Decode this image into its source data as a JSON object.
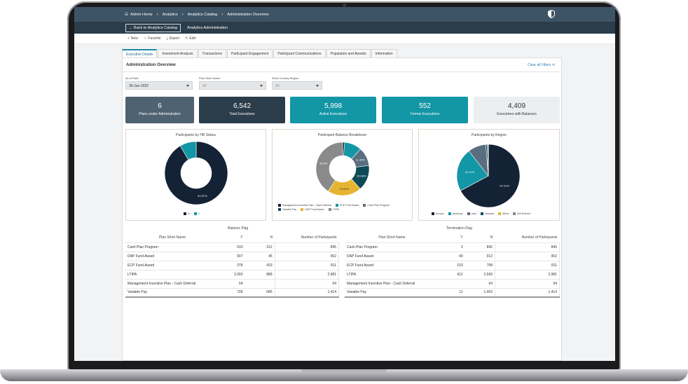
{
  "breadcrumbs": [
    "Admin Home",
    "Analytics",
    "Analytics Catalog",
    "Administration Overview"
  ],
  "subheader": {
    "back_label": "← Back to Analytics Catalog",
    "title": "Analytics Administration"
  },
  "actions": [
    {
      "icon": "+",
      "label": "New"
    },
    {
      "icon": "☆",
      "label": "Favorite"
    },
    {
      "icon": "⤓",
      "label": "Export"
    },
    {
      "icon": "✎",
      "label": "Edit"
    }
  ],
  "tabs": [
    "Executive Details",
    "Investment Analysis",
    "Transactions",
    "Participant Engagement",
    "Participant Communications",
    "Population and Awards",
    "Information"
  ],
  "panel": {
    "title": "Administration Overview",
    "clear_filters": "Clear all Filters ⟲"
  },
  "filters": [
    {
      "label": "As of Date",
      "value": "30-Jun-2022"
    },
    {
      "label": "Plan Short Name",
      "value": "All"
    },
    {
      "label": "Work Country Region",
      "value": "All"
    }
  ],
  "kpis": [
    {
      "value": "6",
      "label": "Plans under Administration",
      "color": "#4e6272"
    },
    {
      "value": "6,542",
      "label": "Total Executives",
      "color": "#2b3c4a"
    },
    {
      "value": "5,998",
      "label": "Active Executives",
      "color": "#1396a6"
    },
    {
      "value": "552",
      "label": "Former Executives",
      "color": "#1396a6"
    },
    {
      "value": "4,409",
      "label": "Executives with Balances",
      "color": "#eceef0",
      "text": "#333333"
    }
  ],
  "chart_data": [
    {
      "type": "pie",
      "title": "Participants by HR Status",
      "categories": [
        "N",
        "Y"
      ],
      "values": [
        91.57,
        8.43
      ],
      "colors": [
        "#142236",
        "#1396a6"
      ],
      "data_labels": [
        "91.57%",
        ""
      ]
    },
    {
      "type": "pie",
      "title": "Participant Balance Breakdown",
      "categories": [
        "Management Incentive Plan - Cash Deferral",
        "ECP Fund Award",
        "Cash Plan Program",
        "Variable Pay",
        "DAP Fund Award",
        "LTIPA"
      ],
      "values": [
        1.2,
        10.5,
        11.3,
        15.5,
        20.6,
        40.9
      ],
      "colors": [
        "#142236",
        "#1396a6",
        "#5a6e80",
        "#0e4a56",
        "#e6b52f",
        "#8a8a8a"
      ],
      "data_labels": [
        "",
        "",
        "11.30%",
        "15.48%",
        "20.63%",
        "40.9%"
      ]
    },
    {
      "type": "pie",
      "title": "Participants by Region",
      "categories": [
        "Europe",
        "Americas",
        "Asia",
        "Oceania",
        "Africa",
        "Not Entered"
      ],
      "values": [
        67.21,
        22.21,
        9.3,
        0.9,
        0.2,
        0.18
      ],
      "colors": [
        "#142236",
        "#1396a6",
        "#5a6e80",
        "#0e4a56",
        "#e6b52f",
        "#8a8a8a"
      ],
      "data_labels": [
        "67.21%",
        "22.21%",
        "",
        "",
        "",
        ""
      ]
    }
  ],
  "tables": [
    {
      "flag": "Balance Flag",
      "headers": [
        "Plan Short Name",
        "Y",
        "N",
        "Number of Participants"
      ],
      "rows": [
        [
          "Cash Plan Program",
          "533",
          "312",
          "845"
        ],
        [
          "DAP Fund Award",
          "907",
          "45",
          "952"
        ],
        [
          "ECP Fund Award",
          "378",
          "433",
          "811"
        ],
        [
          "LTIPA",
          "2,093",
          "888",
          "2,981"
        ],
        [
          "Management Incentive Plan - Cash Deferral",
          "64",
          "",
          "64"
        ],
        [
          "Variable Pay",
          "728",
          "686",
          "1,414"
        ]
      ]
    },
    {
      "flag": "Termination Flag",
      "headers": [
        "Plan Short Name",
        "Y",
        "N",
        "Number of Participants"
      ],
      "rows": [
        [
          "Cash Plan Program",
          "3",
          "842",
          "845"
        ],
        [
          "DAP Fund Award",
          "40",
          "912",
          "952"
        ],
        [
          "ECP Fund Award",
          "103",
          "708",
          "811"
        ],
        [
          "LTIPA",
          "412",
          "2,569",
          "2,981"
        ],
        [
          "Management Incentive Plan - Cash Deferral",
          "",
          "64",
          "64"
        ],
        [
          "Variable Pay",
          "11",
          "1,403",
          "1,414"
        ]
      ]
    }
  ]
}
